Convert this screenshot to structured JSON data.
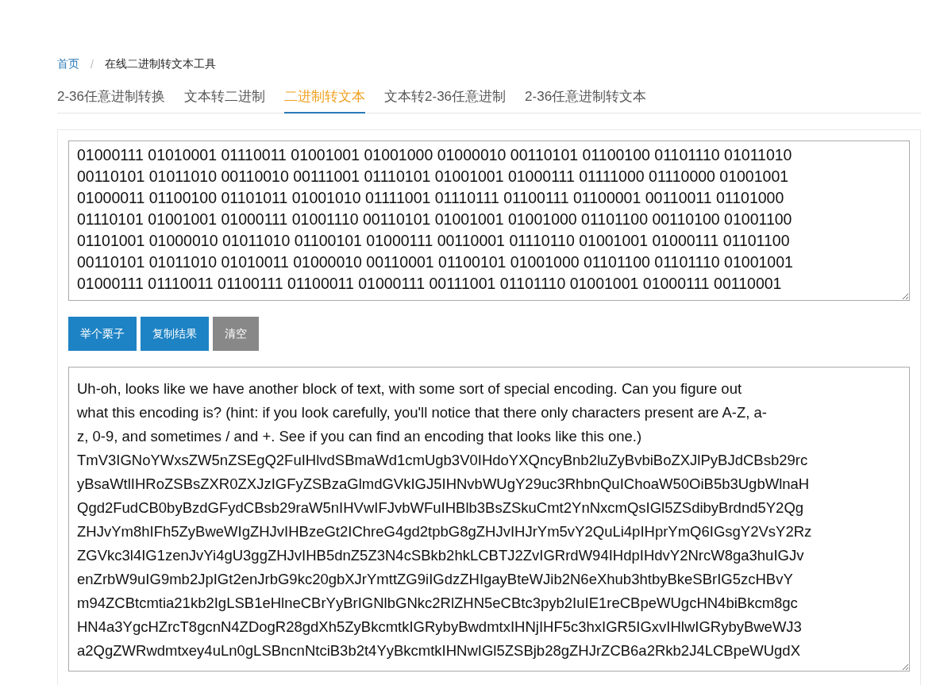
{
  "breadcrumb_separator": "/",
  "breadcrumb": [
    {
      "label": "首页",
      "link": true
    },
    {
      "label": "在线二进制转文本工具",
      "link": false
    }
  ],
  "tabs": [
    {
      "label": "2-36任意进制转换",
      "selected": false
    },
    {
      "label": "文本转二进制",
      "selected": false
    },
    {
      "label": "二进制转文本",
      "selected": true
    },
    {
      "label": "文本转2-36任意进制",
      "selected": false
    },
    {
      "label": "2-36任意进制转文本",
      "selected": false
    }
  ],
  "input": {
    "lines": [
      "01000111 01010001 01110011 01001001 01001000 01000010 00110101 01100100 01101110 01011010",
      "00110101 01011010 00110010 00111001 01110101 01001001 01000111 01111000 01110000 01001001",
      "01000011 01100100 01101011 01001010 01111001 01110111 01100111 01100001 00110011 01101000",
      "01110101 01001001 01000111 01001110 00110101 01001001 01001000 01101100 00110100 01001100",
      "01101001 01000010 01011010 01100101 01000111 00110001 01110110 01001001 01000111 01101100",
      "00110101 01011010 01010011 01000010 00110001 01100101 01001000 01101100 01101110 01001001",
      "01000111 01110011 01100111 01100011 01000111 00111001 01101110 01001001 01000111 00110001"
    ]
  },
  "buttons": [
    {
      "label": "举个栗子",
      "kind": "primary"
    },
    {
      "label": "复制结果",
      "kind": "primary"
    },
    {
      "label": "清空",
      "kind": "secondary"
    }
  ],
  "output": {
    "lines": [
      "Uh-oh, looks like we have another block of text, with some sort of special encoding. Can you figure out",
      "what this encoding is? (hint: if you look carefully, you'll notice that there only characters present are A-Z, a-",
      "z, 0-9, and sometimes / and +. See if you can find an encoding that looks like this one.)",
      "TmV3IGNoYWxsZW5nZSEgQ2FuIHlvdSBmaWd1cmUgb3V0IHdoYXQncyBnb2luZyBvbiBoZXJlPyBJdCBsb29rc",
      "yBsaWtlIHRoZSBsZXR0ZXJzIGFyZSBzaGlmdGVkIGJ5IHNvbWUgY29uc3RhbnQuIChoaW50OiB5b3UgbWlnaH",
      "Qgd2FudCB0byBzdGFydCBsb29raW5nIHVwIFJvbWFuIHBlb3BsZSkuCmt2YnNxcmQsIGl5ZSdibyBrdnd5Y2Qg",
      "ZHJvYm8hIFh5ZyBweWIgZHJvIHBzeGt2IChreG4gd2tpbG8gZHJvIHJrYm5vY2QuLi4pIHprYmQ6IGsgY2VsY2Rz",
      "ZGVkc3l4IG1zenJvYi4gU3ggZHJvIHB5dnZ5Z3N4cSBkb2hkLCBTJ2ZvIGRrdW94IHdpIHdvY2NrcW8ga3huIGJv",
      "enZrbW9uIG9mb2JpIGt2enJrbG9kc20gbXJrYmttZG9iIGdzZHIgayBteWJib2N6eXhub3htbyBkeSBrIG5zcHBvY",
      "m94ZCBtcmtia21kb2IgLSB1eHlneCBrYyBrIGNlbGNkc2RlZHN5eCBtc3pyb2IuIE1reCBpeWUgcHN4biBkcm8gc",
      "HN4a3YgcHZrcT8gcnN4ZDogR28gdXh5ZyBkcmtkIGRybyBwdmtxIHNjIHF5c3hxIGR5IGxvIHlwIGRybyBweWJ3",
      "a2QgZWRwdmtxey4uLn0gLSBncnNtciB3b2t4YyBkcmtkIHNwIGl5ZSBjb28gZHJrZCB6a2Rkb2J4LCBpeWUgdX"
    ]
  }
}
